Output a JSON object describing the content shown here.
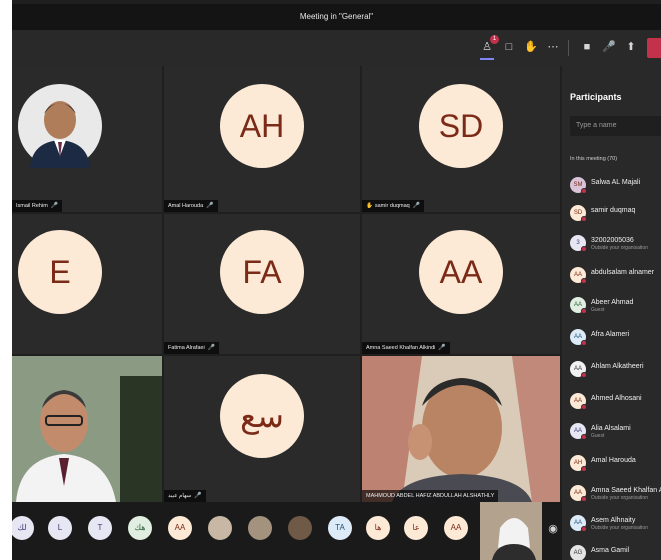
{
  "window": {
    "title": "Meeting in \"General\""
  },
  "controls": {
    "participants_badge": "1",
    "items": [
      "participants",
      "chat",
      "raise-hand",
      "more",
      "camera",
      "mic",
      "share",
      "leave"
    ]
  },
  "tiles": [
    {
      "name": "Ismail Rehim",
      "type": "photo"
    },
    {
      "name": "Amal Harouda",
      "initials": "AH"
    },
    {
      "name": "samir duqmaq",
      "initials": "SD",
      "hand": true
    },
    {
      "name": "",
      "initials": "E"
    },
    {
      "name": "Fatima Alrafaei",
      "initials": "FA"
    },
    {
      "name": "Amna Saeed Khalfan Alkindi",
      "initials": "AA"
    },
    {
      "name": "",
      "type": "video"
    },
    {
      "name": "سهام عبيد",
      "initials": "سع"
    },
    {
      "name": "MAHMOUD ABDEL HAFIZ ABDULLAH ALSHATHLY",
      "type": "video"
    }
  ],
  "panel": {
    "title": "Participants",
    "search_placeholder": "Type a name",
    "section": "In this meeting (70)",
    "people": [
      {
        "name": "Salwa AL Majali",
        "initials": "SM",
        "sub": ""
      },
      {
        "name": "samir duqmaq",
        "initials": "SD",
        "sub": ""
      },
      {
        "name": "32002005036",
        "initials": "3",
        "sub": "Outside your organisation"
      },
      {
        "name": "abdulsalam alnamer",
        "initials": "AA",
        "sub": ""
      },
      {
        "name": "Abeer Ahmad",
        "initials": "AA",
        "sub": "Guest"
      },
      {
        "name": "Afra Alameri",
        "initials": "AA",
        "sub": ""
      },
      {
        "name": "Ahlam Alkatheeri",
        "initials": "AA",
        "sub": ""
      },
      {
        "name": "Ahmed Alhosani",
        "initials": "AA",
        "sub": ""
      },
      {
        "name": "Alia Alsalami",
        "initials": "AA",
        "sub": "Guest"
      },
      {
        "name": "Amal Harouda",
        "initials": "AH",
        "sub": ""
      },
      {
        "name": "Amna Saeed Khalfan Al",
        "initials": "AA",
        "sub": "Outside your organisation"
      },
      {
        "name": "Asem Alhnaity",
        "initials": "AA",
        "sub": "Outside your organisation"
      },
      {
        "name": "Asma Gamil",
        "initials": "AG",
        "sub": ""
      }
    ]
  },
  "strip": [
    {
      "initials": "لك"
    },
    {
      "initials": "L"
    },
    {
      "initials": "T"
    },
    {
      "initials": "هك"
    },
    {
      "initials": "AA"
    },
    {
      "initials": ""
    },
    {
      "initials": ""
    },
    {
      "initials": ""
    },
    {
      "initials": "TA"
    },
    {
      "initials": "ها"
    },
    {
      "initials": "عا"
    },
    {
      "initials": "AA"
    }
  ]
}
